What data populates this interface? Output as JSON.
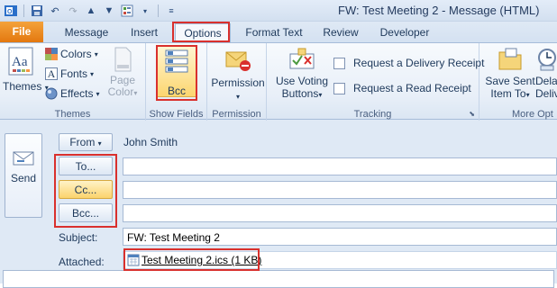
{
  "window": {
    "title": "FW: Test Meeting 2  -  Message (HTML)"
  },
  "tabs": [
    {
      "label": "File"
    },
    {
      "label": "Message"
    },
    {
      "label": "Insert"
    },
    {
      "label": "Options"
    },
    {
      "label": "Format Text"
    },
    {
      "label": "Review"
    },
    {
      "label": "Developer"
    }
  ],
  "ribbon": {
    "themes": {
      "themes_label": "Themes",
      "colors_label": "Colors",
      "fonts_label": "Fonts",
      "effects_label": "Effects",
      "page_color_label": "Page Color",
      "group_label": "Themes"
    },
    "show_fields": {
      "bcc_label": "Bcc",
      "group_label": "Show Fields"
    },
    "permission": {
      "button_label": "Permission",
      "group_label": "Permission"
    },
    "tracking": {
      "voting_label_1": "Use Voting",
      "voting_label_2": "Buttons",
      "delivery_receipt": "Request a Delivery Receipt",
      "read_receipt": "Request a Read Receipt",
      "group_label": "Tracking"
    },
    "more": {
      "save_sent_1": "Save Sent",
      "save_sent_2": "Item To",
      "delay_1": "Delay",
      "delay_2": "Deliv",
      "group_label": "More Opt"
    }
  },
  "compose": {
    "send_label": "Send",
    "from_label": "From",
    "from_value": "John Smith",
    "to_label": "To...",
    "cc_label": "Cc...",
    "bcc_label": "Bcc...",
    "to_value": "",
    "cc_value": "",
    "bcc_value": "",
    "subject_label": "Subject:",
    "subject_value": "FW: Test Meeting 2",
    "attached_label": "Attached:",
    "attachment_name": "Test Meeting 2.ics (1 KB)"
  },
  "accent": {
    "file_tab": "#e3780f",
    "highlight": "#d9302d"
  }
}
